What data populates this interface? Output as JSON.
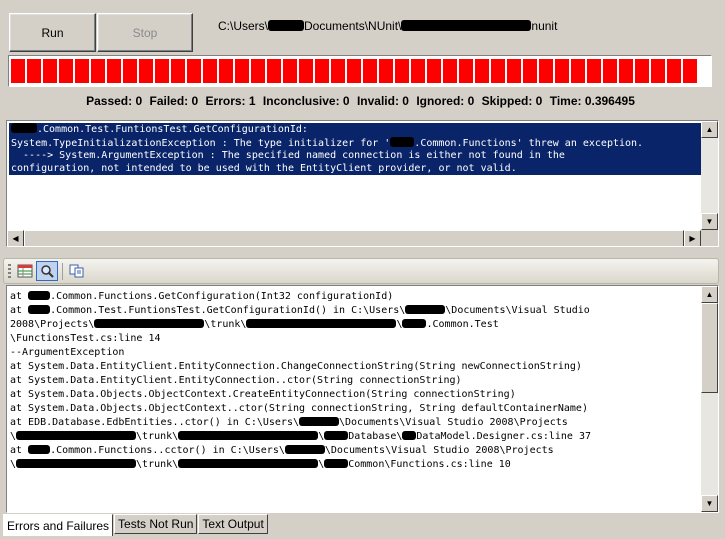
{
  "toolbar": {
    "run_label": "Run",
    "stop_label": "Stop",
    "path_prefix": "C:\\Users\\",
    "path_middle": "Documents\\NUnit\\",
    "path_suffix": "nunit"
  },
  "progress": {
    "fraction": 1.0,
    "color": "#ff0000"
  },
  "counts": {
    "passed": "Passed: 0",
    "failed": "Failed: 0",
    "errors": "Errors: 1",
    "inconclusive": "Inconclusive: 0",
    "invalid": "Invalid: 0",
    "ignored": "Ignored: 0",
    "skipped": "Skipped: 0",
    "time": "Time: 0.396495"
  },
  "error_list": {
    "line1": ".Common.Test.FuntionsTest.GetConfigurationId:",
    "line2a": "System.TypeInitializationException : The type initializer for '",
    "line2b": ".Common.Functions' threw an exception.",
    "line3": "  ----> System.ArgumentException : The specified named connection is either not found in the",
    "line4": "configuration, not intended to be used with the EntityClient provider, or not valid."
  },
  "stack": {
    "l1a": "at ",
    "l1b": ".Common.Functions.GetConfiguration(Int32 configurationId)",
    "l2a": "at ",
    "l2b": ".Common.Test.FuntionsTest.GetConfigurationId() in C:\\Users\\",
    "l2c": "\\Documents\\Visual Studio",
    "l3a": "2008\\Projects\\",
    "l3b": "\\trunk\\",
    "l3c": "\\",
    "l3d": ".Common.Test",
    "l4": "\\FunctionsTest.cs:line 14",
    "l5": "--ArgumentException",
    "l6": "at System.Data.EntityClient.EntityConnection.ChangeConnectionString(String newConnectionString)",
    "l7": "at System.Data.EntityClient.EntityConnection..ctor(String connectionString)",
    "l8": "at System.Data.Objects.ObjectContext.CreateEntityConnection(String connectionString)",
    "l9": "at System.Data.Objects.ObjectContext..ctor(String connectionString, String defaultContainerName)",
    "l10a": "at EDB.Database.EdbEntities..ctor() in C:\\Users\\",
    "l10b": "\\Documents\\Visual Studio 2008\\Projects",
    "l11a": "\\",
    "l11b": "\\trunk\\",
    "l11c": "\\",
    "l11d": "Database\\",
    "l11e": "DataModel.Designer.cs:line 37",
    "l12a": "at ",
    "l12b": ".Common.Functions..cctor() in C:\\Users\\",
    "l12c": "\\Documents\\Visual Studio 2008\\Projects",
    "l13a": "\\",
    "l13b": "\\trunk\\",
    "l13c": "\\",
    "l13d": "Common\\Functions.cs:line 10"
  },
  "tabs": [
    "Errors and Failures",
    "Tests Not Run",
    "Text Output"
  ],
  "icons": [
    "grid-icon",
    "find-icon",
    "copy-icon"
  ]
}
